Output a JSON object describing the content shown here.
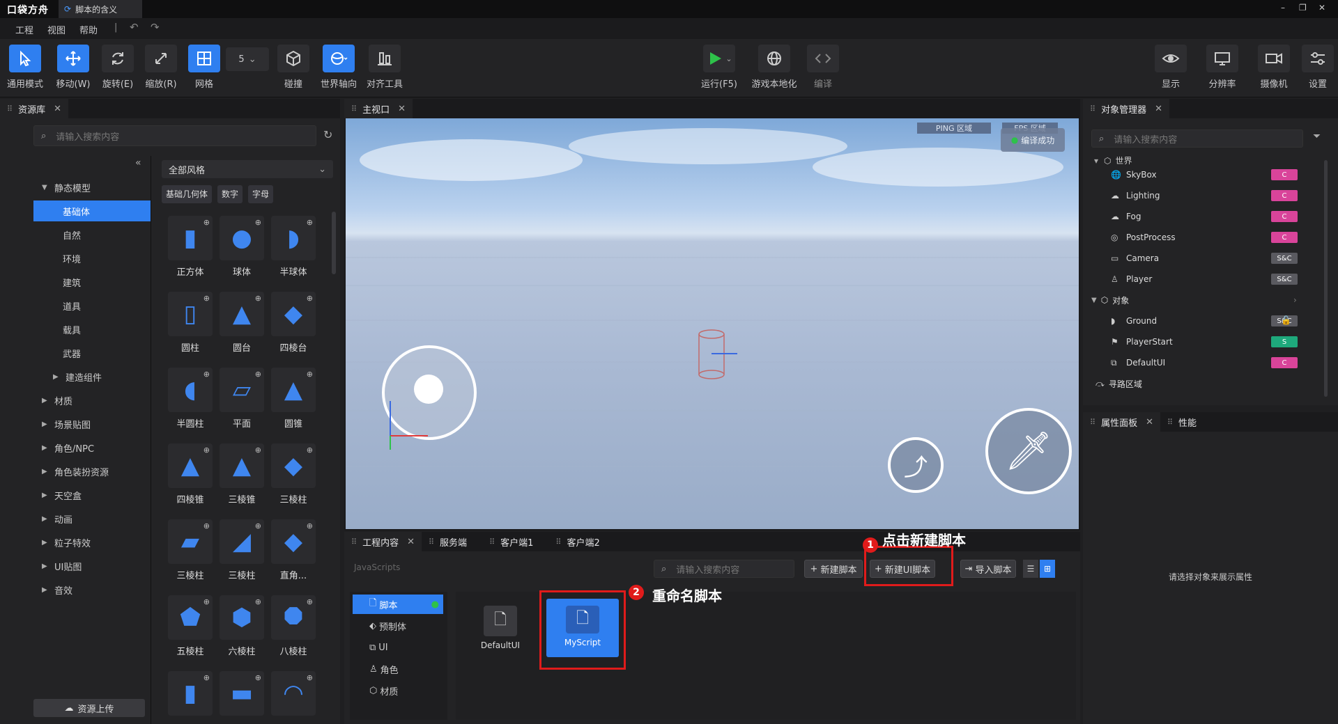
{
  "titlebar": {
    "logo": "口袋方舟",
    "tab_title": "脚本的含义",
    "min": "–",
    "restore": "❐",
    "close": "✕"
  },
  "menu": {
    "items": [
      "工程",
      "视图",
      "帮助"
    ],
    "sep": "|",
    "undo": "↶",
    "redo": "↷"
  },
  "toolbar": {
    "general": "通用模式",
    "move": "移动(W)",
    "rotate": "旋转(E)",
    "scale": "缩放(R)",
    "grid": "网格",
    "grid_value": "5",
    "collision": "碰撞",
    "world_axis": "世界轴向",
    "align": "对齐工具",
    "run": "运行(F5)",
    "localize": "游戏本地化",
    "compile": "编译",
    "display": "显示",
    "resolution": "分辨率",
    "camera": "摄像机",
    "settings": "设置"
  },
  "assets": {
    "tab": "资源库",
    "search_placeholder": "请输入搜索内容",
    "collapse": "«",
    "upload": "资源上传",
    "tree": [
      {
        "label": "静态模型",
        "level": 0,
        "arrow": "▼"
      },
      {
        "label": "基础体",
        "level": 1,
        "arrow": "",
        "selected": true
      },
      {
        "label": "自然",
        "level": 1,
        "arrow": ""
      },
      {
        "label": "环境",
        "level": 1,
        "arrow": ""
      },
      {
        "label": "建筑",
        "level": 1,
        "arrow": ""
      },
      {
        "label": "道具",
        "level": 1,
        "arrow": ""
      },
      {
        "label": "载具",
        "level": 1,
        "arrow": ""
      },
      {
        "label": "武器",
        "level": 1,
        "arrow": ""
      },
      {
        "label": "建造组件",
        "level": 1,
        "arrow": "▶"
      },
      {
        "label": "材质",
        "level": 0,
        "arrow": "▶"
      },
      {
        "label": "场景贴图",
        "level": 0,
        "arrow": "▶"
      },
      {
        "label": "角色/NPC",
        "level": 0,
        "arrow": "▶"
      },
      {
        "label": "角色装扮资源",
        "level": 0,
        "arrow": "▶"
      },
      {
        "label": "天空盒",
        "level": 0,
        "arrow": "▶"
      },
      {
        "label": "动画",
        "level": 0,
        "arrow": "▶"
      },
      {
        "label": "粒子特效",
        "level": 0,
        "arrow": "▶"
      },
      {
        "label": "UI贴图",
        "level": 0,
        "arrow": "▶"
      },
      {
        "label": "音效",
        "level": 0,
        "arrow": "▶"
      }
    ],
    "style_select": "全部风格",
    "style_arrow": "⌄",
    "filters": [
      "基础几何体",
      "数字",
      "字母"
    ],
    "items": [
      "正方体",
      "球体",
      "半球体",
      "圆柱",
      "圆台",
      "四棱台",
      "半圆柱",
      "平面",
      "圆锥",
      "四棱锥",
      "三棱锥",
      "三棱柱",
      "三棱柱",
      "三棱柱",
      "直角...",
      "五棱柱",
      "六棱柱",
      "八棱柱",
      "",
      "",
      ""
    ]
  },
  "viewport": {
    "tab": "主视口",
    "ping": "PING 区域",
    "fps": "FPS 区域",
    "compile_ok": "编译成功"
  },
  "project": {
    "tabs": [
      "工程内容",
      "服务端",
      "客户端1",
      "客户端2"
    ],
    "path": "JavaScripts",
    "search_placeholder": "请输入搜索内容",
    "new_script": "新建脚本",
    "new_ui_script": "新建UI脚本",
    "import_script": "导入脚本",
    "folders": [
      "脚本",
      "预制体",
      "UI",
      "角色",
      "材质"
    ],
    "files": [
      "DefaultUI",
      "MyScript"
    ]
  },
  "annotations": {
    "a1_num": "1",
    "a1_text": "点击新建脚本",
    "a2_num": "2",
    "a2_text": "重命名脚本"
  },
  "objects": {
    "tab": "对象管理器",
    "search_placeholder": "请输入搜索内容",
    "world": "世界",
    "items": [
      {
        "label": "SkyBox",
        "badge": "C",
        "color": "#d9449a"
      },
      {
        "label": "Lighting",
        "badge": "C",
        "color": "#d9449a"
      },
      {
        "label": "Fog",
        "badge": "C",
        "color": "#d9449a"
      },
      {
        "label": "PostProcess",
        "badge": "C",
        "color": "#d9449a"
      },
      {
        "label": "Camera",
        "badge": "S&C",
        "color": "#5a5a60"
      },
      {
        "label": "Player",
        "badge": "S&C",
        "color": "#5a5a60"
      }
    ],
    "group": "对象",
    "group_items": [
      {
        "label": "Ground",
        "badge": "S&C",
        "color": "#5a5a60"
      },
      {
        "label": "PlayerStart",
        "badge": "S",
        "color": "#1ea97c"
      },
      {
        "label": "DefaultUI",
        "badge": "C",
        "color": "#d9449a"
      }
    ],
    "nav": "寻路区域"
  },
  "properties": {
    "tab": "属性面板",
    "tab2": "性能",
    "empty": "请选择对象来展示属性"
  },
  "colors": {
    "accent": "#2f7ff0",
    "annotation": "#e01b1b"
  }
}
